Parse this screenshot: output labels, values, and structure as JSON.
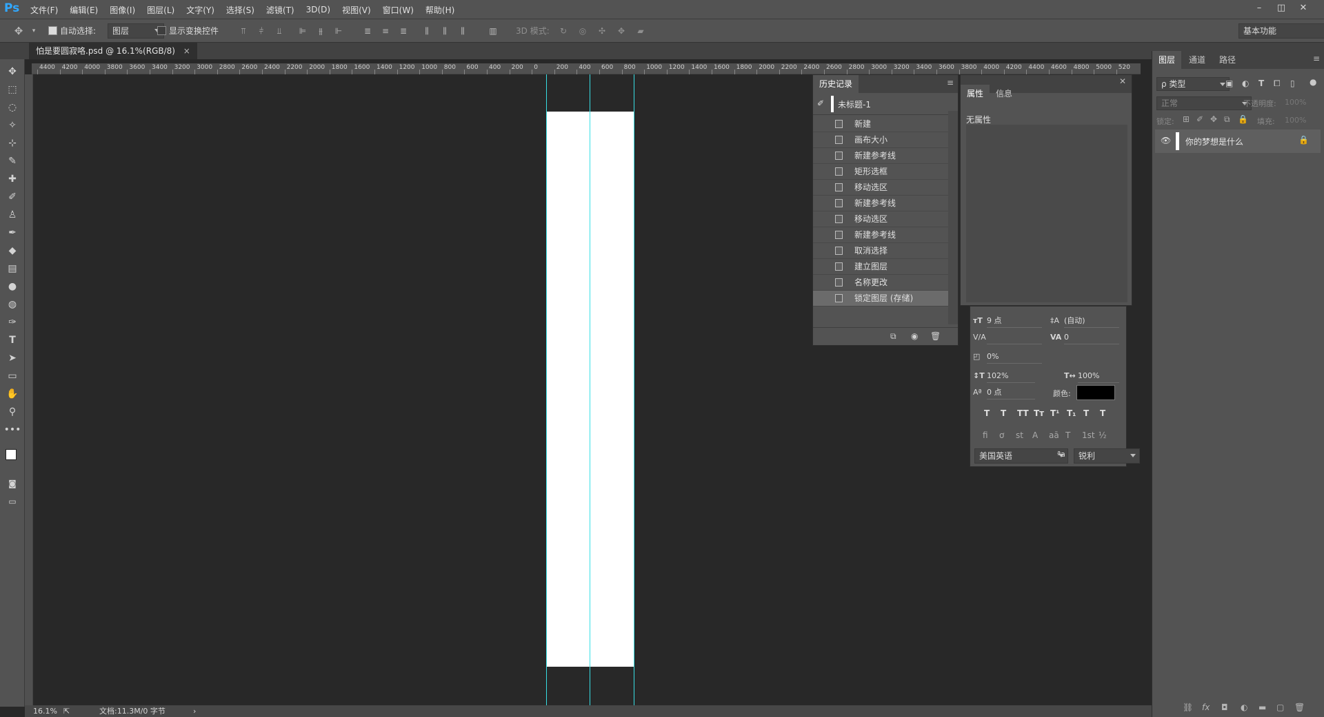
{
  "app": {
    "logo": "Ps"
  },
  "menu": [
    "文件(F)",
    "编辑(E)",
    "图像(I)",
    "图层(L)",
    "文字(Y)",
    "选择(S)",
    "滤镜(T)",
    "3D(D)",
    "视图(V)",
    "窗口(W)",
    "帮助(H)"
  ],
  "window_buttons": [
    "–",
    "◫",
    "✕"
  ],
  "options": {
    "auto_select_label": "自动选择:",
    "auto_select_value": "图层",
    "show_transform_label": "显示变换控件",
    "mode_3d_label": "3D 模式:",
    "workspace": "基本功能"
  },
  "document": {
    "tab_title": "怕是要圆寂咯.psd @ 16.1%(RGB/8)",
    "close": "×"
  },
  "ruler_labels": [
    "4400",
    "4200",
    "4000",
    "3800",
    "3600",
    "3400",
    "3200",
    "3000",
    "2800",
    "2600",
    "2400",
    "2200",
    "2000",
    "1800",
    "1600",
    "1400",
    "1200",
    "1000",
    "800",
    "600",
    "400",
    "200",
    "0",
    "200",
    "400",
    "600",
    "800",
    "1000",
    "1200",
    "1400",
    "1600",
    "1800",
    "2000",
    "2200",
    "2400",
    "2600",
    "2800",
    "3000",
    "3200",
    "3400",
    "3600",
    "3800",
    "4000",
    "4200",
    "4400",
    "4600",
    "4800",
    "5000",
    "520"
  ],
  "status": {
    "zoom": "16.1%",
    "doc_info": "文档:11.3M/0 字节",
    "arrow": "›"
  },
  "history": {
    "tab": "历史记录",
    "snapshot": "未标题-1",
    "items": [
      "新建",
      "画布大小",
      "新建参考线",
      "矩形选框",
      "移动选区",
      "新建参考线",
      "移动选区",
      "新建参考线",
      "取消选择",
      "建立图层",
      "名称更改",
      "锁定图层 (存储)"
    ]
  },
  "properties": {
    "tabs": [
      "属性",
      "信息"
    ],
    "empty": "无属性"
  },
  "character": {
    "font_size": "9 点",
    "leading": "(自动)",
    "kerning": "",
    "tracking": "0",
    "tsume": "0%",
    "vscale": "102%",
    "hscale": "100%",
    "baseline": "0 点",
    "color_label": "颜色:",
    "color": "#000000",
    "language": "美国英语",
    "antialias_label": "ªa",
    "antialias": "锐利",
    "format_buttons": [
      "T",
      "T",
      "TT",
      "Tт",
      "T¹",
      "T₁",
      "T",
      "T"
    ],
    "ot_buttons": [
      "fi",
      "ơ",
      "st",
      "A",
      "aā",
      "T",
      "1st",
      "½"
    ]
  },
  "layers": {
    "tabs": [
      "图层",
      "通道",
      "路径"
    ],
    "filter": "ρ 类型",
    "blend_mode": "正常",
    "opacity_label": "不透明度:",
    "opacity": "100%",
    "lock_label": "锁定:",
    "fill_label": "填充:",
    "fill": "100%",
    "items": [
      {
        "name": "你的梦想是什么",
        "visible": true,
        "locked": true
      }
    ]
  },
  "colors": {
    "accent": "#31a8ff",
    "guide": "#37e0e6",
    "panel": "#535353",
    "canvas": "#282828"
  }
}
